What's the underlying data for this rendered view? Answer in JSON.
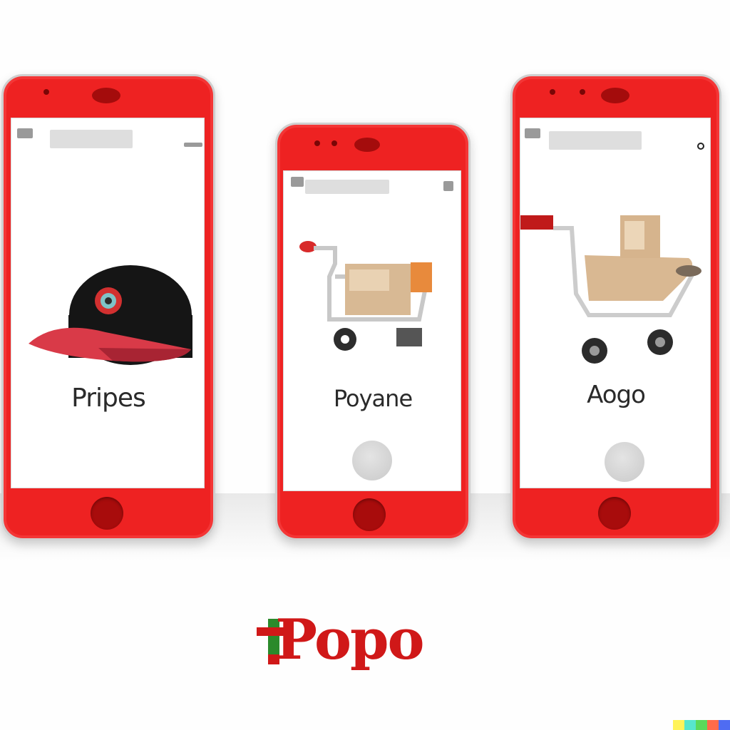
{
  "screens": [
    {
      "product_name": "Pripes",
      "illustration": "baseball-cap"
    },
    {
      "product_name": "Poyane",
      "illustration": "shopping-cart-with-box"
    },
    {
      "product_name": "Aogo",
      "illustration": "shopping-cart-with-box"
    }
  ],
  "brand": {
    "logo_text": "Popo"
  },
  "colors": {
    "phone_body": "#ee2222",
    "camera_and_home": "#a80c0c",
    "screen": "#ffffff",
    "search_bar": "#dedede",
    "action_button": "#d2d2d2"
  },
  "watermark_colors": [
    "#fff35a",
    "#57e6cc",
    "#5bd95a",
    "#ff6b4a",
    "#4f6cf2"
  ]
}
